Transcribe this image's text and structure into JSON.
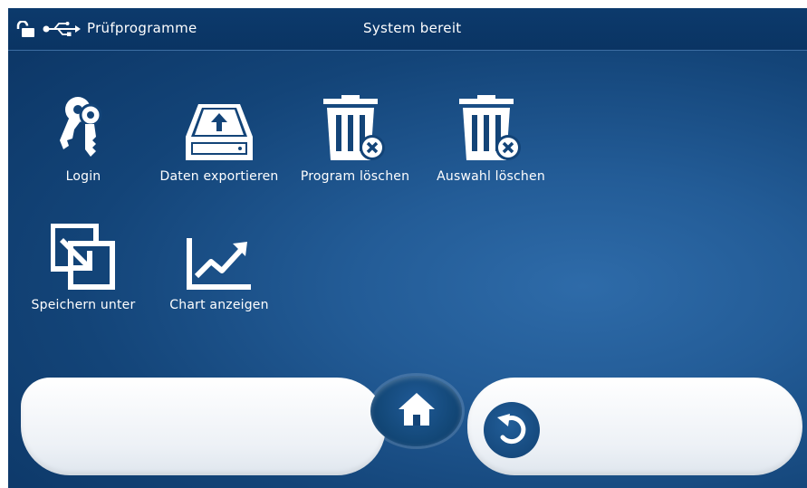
{
  "status_bar": {
    "title": "Prüfprogramme",
    "status": "System bereit",
    "lock_icon": "unlock-icon",
    "usb_icon": "usb-icon"
  },
  "tiles": [
    {
      "label": "Login",
      "icon": "keys-icon"
    },
    {
      "label": "Daten exportieren",
      "icon": "export-drive-icon"
    },
    {
      "label": "Program löschen",
      "icon": "trash-delete-icon"
    },
    {
      "label": "Auswahl löschen",
      "icon": "trash-delete-icon"
    },
    {
      "label": "Speichern unter",
      "icon": "save-as-icon"
    },
    {
      "label": "Chart anzeigen",
      "icon": "chart-icon"
    }
  ],
  "dock": {
    "home_icon": "home-icon",
    "back_icon": "undo-icon"
  },
  "colors": {
    "background": "#134478",
    "status_bar": "#0a3463",
    "icon": "#ffffff",
    "dock": "#eef2f7"
  }
}
